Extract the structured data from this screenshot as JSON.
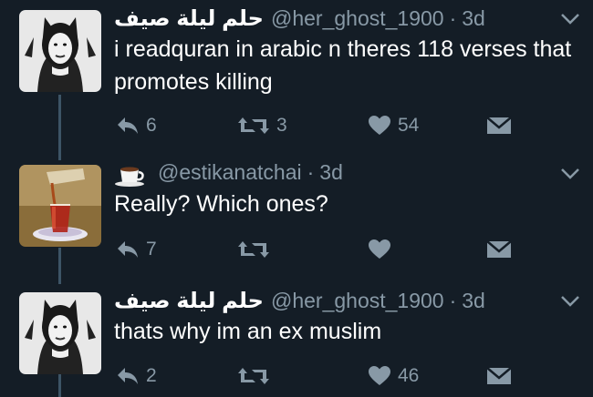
{
  "tweets": [
    {
      "display_name": "حلم ليلة صيف",
      "handle": "@her_ghost_1900",
      "separator": "·",
      "time": "3d",
      "text": "i readquran in arabic n theres 118 verses that promotes killing",
      "reply_count": "6",
      "retweet_count": "3",
      "like_count": "54"
    },
    {
      "display_name_icon": "coffee-cup-emoji",
      "handle": "@estikanatchai",
      "separator": "·",
      "time": "3d",
      "text": "Really? Which ones?",
      "reply_count": "7",
      "retweet_count": "",
      "like_count": ""
    },
    {
      "display_name": "حلم ليلة صيف",
      "handle": "@her_ghost_1900",
      "separator": "·",
      "time": "3d",
      "text": "thats why im an ex muslim",
      "reply_count": "2",
      "retweet_count": "",
      "like_count": "46"
    }
  ],
  "icons": {
    "reply": "reply-icon",
    "retweet": "retweet-icon",
    "like": "heart-icon",
    "message": "direct-message-icon",
    "more": "chevron-down-icon"
  },
  "colors": {
    "background": "#141d26",
    "secondary_text": "#8899a6",
    "icon": "#8899a6",
    "thread_line": "#3d5466"
  }
}
